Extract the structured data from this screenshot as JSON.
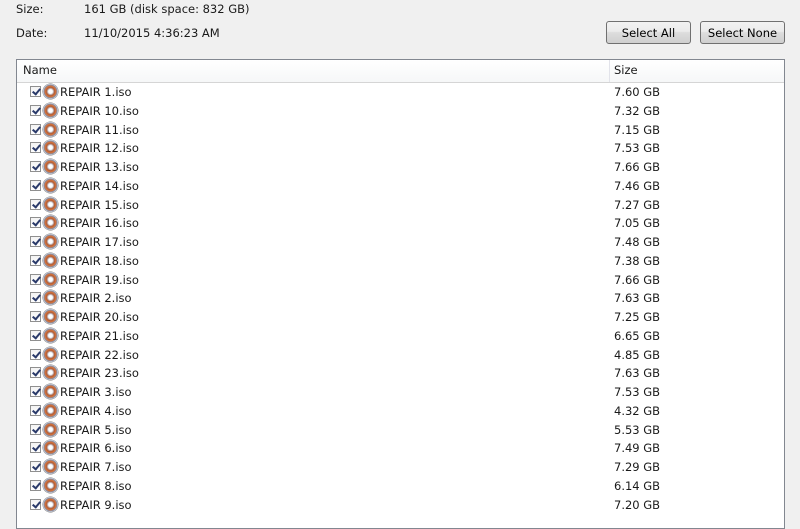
{
  "info": {
    "size_label": "Size:",
    "size_value": "161 GB (disk space: 832 GB)",
    "date_label": "Date:",
    "date_value": "11/10/2015 4:36:23 AM"
  },
  "buttons": {
    "select_all": "Select All",
    "select_none": "Select None"
  },
  "columns": {
    "name": "Name",
    "size": "Size"
  },
  "files": [
    {
      "name": "REPAIR 1.iso",
      "size": "7.60 GB",
      "checked": true
    },
    {
      "name": "REPAIR 10.iso",
      "size": "7.32 GB",
      "checked": true
    },
    {
      "name": "REPAIR 11.iso",
      "size": "7.15 GB",
      "checked": true
    },
    {
      "name": "REPAIR 12.iso",
      "size": "7.53 GB",
      "checked": true
    },
    {
      "name": "REPAIR 13.iso",
      "size": "7.66 GB",
      "checked": true
    },
    {
      "name": "REPAIR 14.iso",
      "size": "7.46 GB",
      "checked": true
    },
    {
      "name": "REPAIR 15.iso",
      "size": "7.27 GB",
      "checked": true
    },
    {
      "name": "REPAIR 16.iso",
      "size": "7.05 GB",
      "checked": true
    },
    {
      "name": "REPAIR 17.iso",
      "size": "7.48 GB",
      "checked": true
    },
    {
      "name": "REPAIR 18.iso",
      "size": "7.38 GB",
      "checked": true
    },
    {
      "name": "REPAIR 19.iso",
      "size": "7.66 GB",
      "checked": true
    },
    {
      "name": "REPAIR 2.iso",
      "size": "7.63 GB",
      "checked": true
    },
    {
      "name": "REPAIR 20.iso",
      "size": "7.25 GB",
      "checked": true
    },
    {
      "name": "REPAIR 21.iso",
      "size": "6.65 GB",
      "checked": true
    },
    {
      "name": "REPAIR 22.iso",
      "size": "4.85 GB",
      "checked": true
    },
    {
      "name": "REPAIR 23.iso",
      "size": "7.63 GB",
      "checked": true
    },
    {
      "name": "REPAIR 3.iso",
      "size": "7.53 GB",
      "checked": true
    },
    {
      "name": "REPAIR 4.iso",
      "size": "4.32 GB",
      "checked": true
    },
    {
      "name": "REPAIR 5.iso",
      "size": "5.53 GB",
      "checked": true
    },
    {
      "name": "REPAIR 6.iso",
      "size": "7.49 GB",
      "checked": true
    },
    {
      "name": "REPAIR 7.iso",
      "size": "7.29 GB",
      "checked": true
    },
    {
      "name": "REPAIR 8.iso",
      "size": "6.14 GB",
      "checked": true
    },
    {
      "name": "REPAIR 9.iso",
      "size": "7.20 GB",
      "checked": true
    }
  ],
  "icons": {
    "file": "disc-image-icon",
    "check": "checkbox-checked-icon"
  }
}
